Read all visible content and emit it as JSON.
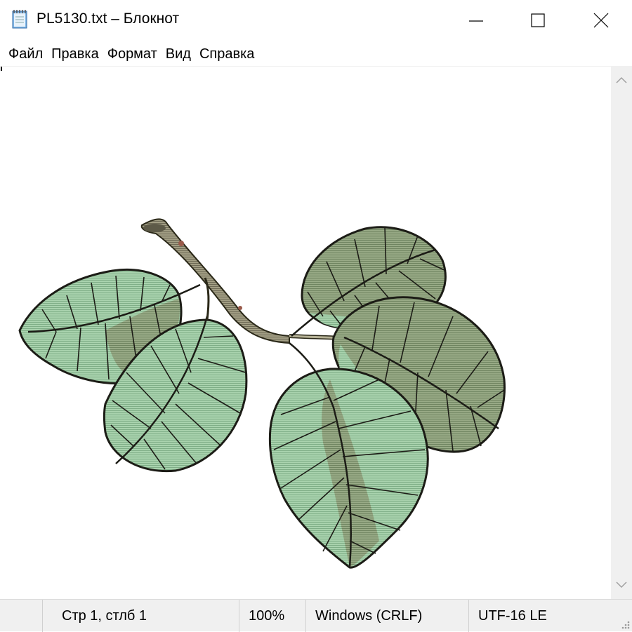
{
  "window": {
    "title": "PL5130.txt – Блокнот",
    "controls": {
      "minimize": "minimize-icon",
      "maximize": "maximize-icon",
      "close": "close-icon"
    }
  },
  "menu": {
    "items": [
      {
        "label": "Файл"
      },
      {
        "label": "Правка"
      },
      {
        "label": "Формат"
      },
      {
        "label": "Вид"
      },
      {
        "label": "Справка"
      }
    ]
  },
  "editor": {
    "content_image": "leaf-branch-ascii-art",
    "colors": {
      "leaf_light": "#9cc8a2",
      "leaf_dark": "#8fa37c",
      "vein": "#1c1c16",
      "stem": "#9d9a7f"
    }
  },
  "status": {
    "position": "Стр 1, стлб 1",
    "zoom": "100%",
    "line_endings": "Windows (CRLF)",
    "encoding": "UTF-16 LE"
  },
  "colors": {
    "chrome": "#f0f0f0",
    "text": "#000000"
  }
}
